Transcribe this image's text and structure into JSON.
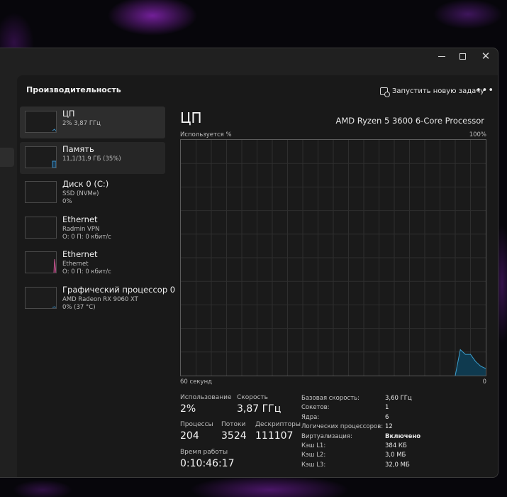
{
  "window": {
    "controls": {
      "minimize": "minimize",
      "maximize": "maximize",
      "close": "close"
    }
  },
  "header": {
    "title": "Производительность",
    "run_task_label": "Запустить новую задачу",
    "more_label": "•••"
  },
  "resources": [
    {
      "name": "ЦП",
      "sub1": "2% 3,87 ГГц",
      "sub2": "",
      "active": true,
      "color": "#3b8fc7"
    },
    {
      "name": "Память",
      "sub1": "11,1/31,9 ГБ (35%)",
      "sub2": "",
      "active": true,
      "color": "#3b8fc7"
    },
    {
      "name": "Диск 0 (C:)",
      "sub1": "SSD (NVMe)",
      "sub2": "0%",
      "active": false,
      "color": "#4fa34f"
    },
    {
      "name": "Ethernet",
      "sub1": "Radmin VPN",
      "sub2": "О: 0 П: 0 кбит/с",
      "active": false,
      "color": "#c2578f"
    },
    {
      "name": "Ethernet",
      "sub1": "Ethernet",
      "sub2": "О: 0 П: 0 кбит/с",
      "active": false,
      "color": "#c2578f"
    },
    {
      "name": "Графический процессор 0",
      "sub1": "AMD Radeon RX 9060 XT",
      "sub2": "0% (37 °C)",
      "active": false,
      "color": "#3b8fc7"
    }
  ],
  "detail": {
    "title": "ЦП",
    "cpu_name": "AMD Ryzen 5 3600 6-Core Processor",
    "axis_top_left": "Используется %",
    "axis_top_right": "100%",
    "axis_bottom_left": "60 секунд",
    "axis_bottom_right": "0",
    "graph_color": "#3ca0cf",
    "graph_fill": "#0f3a4f",
    "usage_history": [
      0,
      0,
      0,
      0,
      0,
      0,
      0,
      0,
      0,
      0,
      0,
      0,
      0,
      0,
      0,
      0,
      0,
      0,
      0,
      0,
      0,
      0,
      0,
      0,
      0,
      0,
      0,
      0,
      0,
      0,
      0,
      0,
      0,
      0,
      0,
      0,
      0,
      0,
      0,
      0,
      0,
      0,
      0,
      0,
      0,
      0,
      0,
      0,
      0,
      0,
      0,
      0,
      0,
      0,
      0,
      11,
      9,
      9,
      6,
      4,
      3
    ],
    "stats": {
      "usage_label": "Использование",
      "usage_value": "2%",
      "speed_label": "Скорость",
      "speed_value": "3,87 ГГц",
      "processes_label": "Процессы",
      "processes_value": "204",
      "threads_label": "Потоки",
      "threads_value": "3524",
      "handles_label": "Дескрипторы",
      "handles_value": "111107",
      "uptime_label": "Время работы",
      "uptime_value": "0:10:46:17"
    },
    "specs": [
      {
        "key": "Базовая скорость:",
        "value": "3,60 ГГц",
        "bold": false
      },
      {
        "key": "Сокетов:",
        "value": "1",
        "bold": false
      },
      {
        "key": "Ядра:",
        "value": "6",
        "bold": false
      },
      {
        "key": "Логических процессоров:",
        "value": "12",
        "bold": false
      },
      {
        "key": "Виртуализация:",
        "value": "Включено",
        "bold": true
      },
      {
        "key": "Кэш L1:",
        "value": "384 КБ",
        "bold": false
      },
      {
        "key": "Кэш L2:",
        "value": "3,0 МБ",
        "bold": false
      },
      {
        "key": "Кэш L3:",
        "value": "32,0 МБ",
        "bold": false
      }
    ]
  }
}
